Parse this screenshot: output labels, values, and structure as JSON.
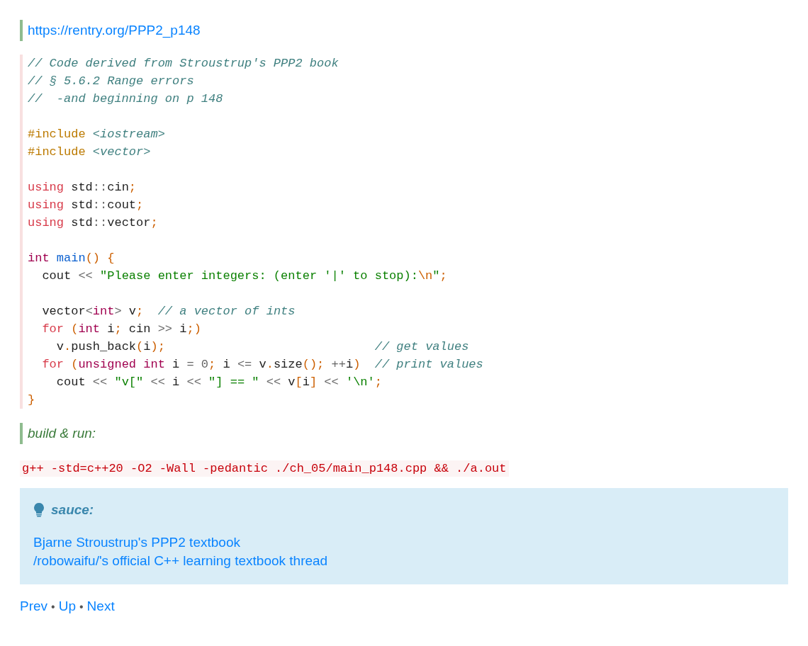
{
  "source_link": "https://rentry.org/PPP2_p148",
  "code_lines": [
    {
      "kind": "code",
      "tokens": [
        {
          "kind": "comment",
          "text": "// Code derived from Stroustrup's PPP2 book"
        }
      ]
    },
    {
      "kind": "code",
      "tokens": [
        {
          "kind": "comment",
          "text": "// § 5.6.2 Range errors"
        }
      ]
    },
    {
      "kind": "code",
      "tokens": [
        {
          "kind": "comment",
          "text": "//  -and beginning on p 148"
        }
      ]
    },
    {
      "kind": "blank"
    },
    {
      "kind": "code",
      "tokens": [
        {
          "kind": "preproc",
          "text": "#include "
        },
        {
          "kind": "comment",
          "text": "<iostream>"
        }
      ]
    },
    {
      "kind": "code",
      "tokens": [
        {
          "kind": "preproc",
          "text": "#include "
        },
        {
          "kind": "comment",
          "text": "<vector>"
        }
      ]
    },
    {
      "kind": "blank"
    },
    {
      "kind": "code",
      "tokens": [
        {
          "kind": "keyword",
          "text": "using"
        },
        {
          "kind": "plain",
          "text": " std"
        },
        {
          "kind": "op",
          "text": "::"
        },
        {
          "kind": "plain",
          "text": "cin"
        },
        {
          "kind": "punct",
          "text": ";"
        }
      ]
    },
    {
      "kind": "code",
      "tokens": [
        {
          "kind": "keyword",
          "text": "using"
        },
        {
          "kind": "plain",
          "text": " std"
        },
        {
          "kind": "op",
          "text": "::"
        },
        {
          "kind": "plain",
          "text": "cout"
        },
        {
          "kind": "punct",
          "text": ";"
        }
      ]
    },
    {
      "kind": "code",
      "tokens": [
        {
          "kind": "keyword",
          "text": "using"
        },
        {
          "kind": "plain",
          "text": " std"
        },
        {
          "kind": "op",
          "text": "::"
        },
        {
          "kind": "plain",
          "text": "vector"
        },
        {
          "kind": "punct",
          "text": ";"
        }
      ]
    },
    {
      "kind": "blank"
    },
    {
      "kind": "code",
      "tokens": [
        {
          "kind": "type",
          "text": "int "
        },
        {
          "kind": "func",
          "text": "main"
        },
        {
          "kind": "punct",
          "text": "() {"
        }
      ]
    },
    {
      "kind": "code",
      "tokens": [
        {
          "kind": "plain",
          "text": "  cout "
        },
        {
          "kind": "op",
          "text": "<< "
        },
        {
          "kind": "string",
          "text": "\"Please enter integers: (enter '|' to stop):"
        },
        {
          "kind": "escape",
          "text": "\\n"
        },
        {
          "kind": "string",
          "text": "\""
        },
        {
          "kind": "punct",
          "text": ";"
        }
      ]
    },
    {
      "kind": "blank"
    },
    {
      "kind": "code",
      "tokens": [
        {
          "kind": "plain",
          "text": "  vector"
        },
        {
          "kind": "op",
          "text": "<"
        },
        {
          "kind": "type",
          "text": "int"
        },
        {
          "kind": "op",
          "text": ">"
        },
        {
          "kind": "plain",
          "text": " v"
        },
        {
          "kind": "punct",
          "text": ";  "
        },
        {
          "kind": "comment",
          "text": "// a vector of ints"
        }
      ]
    },
    {
      "kind": "code",
      "tokens": [
        {
          "kind": "keyword",
          "text": "  for "
        },
        {
          "kind": "punct",
          "text": "("
        },
        {
          "kind": "type",
          "text": "int"
        },
        {
          "kind": "plain",
          "text": " i"
        },
        {
          "kind": "punct",
          "text": ";"
        },
        {
          "kind": "plain",
          "text": " cin "
        },
        {
          "kind": "op",
          "text": ">>"
        },
        {
          "kind": "plain",
          "text": " i"
        },
        {
          "kind": "punct",
          "text": ";)"
        }
      ]
    },
    {
      "kind": "code",
      "tokens": [
        {
          "kind": "plain",
          "text": "    v"
        },
        {
          "kind": "punct",
          "text": "."
        },
        {
          "kind": "plain",
          "text": "push_back"
        },
        {
          "kind": "punct",
          "text": "("
        },
        {
          "kind": "plain",
          "text": "i"
        },
        {
          "kind": "punct",
          "text": ");                             "
        },
        {
          "kind": "comment",
          "text": "// get values"
        }
      ]
    },
    {
      "kind": "code",
      "tokens": [
        {
          "kind": "keyword",
          "text": "  for "
        },
        {
          "kind": "punct",
          "text": "("
        },
        {
          "kind": "type",
          "text": "unsigned int"
        },
        {
          "kind": "plain",
          "text": " i "
        },
        {
          "kind": "op",
          "text": "= "
        },
        {
          "kind": "number",
          "text": "0"
        },
        {
          "kind": "punct",
          "text": ";"
        },
        {
          "kind": "plain",
          "text": " i "
        },
        {
          "kind": "op",
          "text": "<="
        },
        {
          "kind": "plain",
          "text": " v"
        },
        {
          "kind": "punct",
          "text": "."
        },
        {
          "kind": "plain",
          "text": "size"
        },
        {
          "kind": "punct",
          "text": "(); "
        },
        {
          "kind": "op",
          "text": "++"
        },
        {
          "kind": "plain",
          "text": "i"
        },
        {
          "kind": "punct",
          "text": ")  "
        },
        {
          "kind": "comment",
          "text": "// print values"
        }
      ]
    },
    {
      "kind": "code",
      "tokens": [
        {
          "kind": "plain",
          "text": "    cout "
        },
        {
          "kind": "op",
          "text": "<< "
        },
        {
          "kind": "string",
          "text": "\"v[\" "
        },
        {
          "kind": "op",
          "text": "<<"
        },
        {
          "kind": "plain",
          "text": " i "
        },
        {
          "kind": "op",
          "text": "<< "
        },
        {
          "kind": "string",
          "text": "\"] == \" "
        },
        {
          "kind": "op",
          "text": "<<"
        },
        {
          "kind": "plain",
          "text": " v"
        },
        {
          "kind": "punct",
          "text": "["
        },
        {
          "kind": "plain",
          "text": "i"
        },
        {
          "kind": "punct",
          "text": "]"
        },
        {
          "kind": "op",
          "text": " << "
        },
        {
          "kind": "string",
          "text": "'\\n'"
        },
        {
          "kind": "punct",
          "text": ";"
        }
      ]
    },
    {
      "kind": "code",
      "tokens": [
        {
          "kind": "punct",
          "text": "}"
        }
      ]
    }
  ],
  "build_note": "build & run:",
  "build_command": "g++ -std=c++20 -O2 -Wall -pedantic ./ch_05/main_p148.cpp && ./a.out",
  "sauce_box": {
    "title": "sauce:",
    "links": [
      "Bjarne Stroustrup's PPP2 textbook",
      "/robowaifu/'s official C++ learning textbook thread"
    ]
  },
  "nav": {
    "links": [
      "Prev",
      "Up",
      "Next"
    ],
    "separator": "•"
  }
}
